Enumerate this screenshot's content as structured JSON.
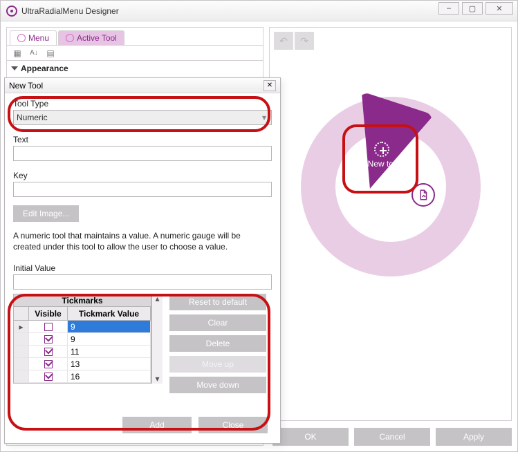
{
  "window": {
    "title": "UltraRadialMenu Designer",
    "buttons": {
      "min": "–",
      "max": "▢",
      "close": "✕"
    }
  },
  "tabs": {
    "menu": "Menu",
    "active_tool": "Active Tool"
  },
  "prop": {
    "section": "Appearance"
  },
  "preview": {
    "wedge_label": "New tool"
  },
  "footer": {
    "ok": "OK",
    "cancel": "Cancel",
    "apply": "Apply"
  },
  "modal": {
    "title": "New Tool",
    "tool_type_label": "Tool Type",
    "tool_type_value": "Numeric",
    "text_label": "Text",
    "text_value": "",
    "key_label": "Key",
    "key_value": "",
    "edit_image": "Edit Image...",
    "description": "A numeric tool that maintains a value. A numeric gauge will be created under this tool to allow the user to choose a value.",
    "initial_value_label": "Initial Value",
    "initial_value": "",
    "tickmarks": {
      "title": "Tickmarks",
      "col_visible": "Visible",
      "col_value": "Tickmark Value",
      "rows": [
        {
          "selected": true,
          "visible": false,
          "value": "9"
        },
        {
          "selected": false,
          "visible": true,
          "value": "9"
        },
        {
          "selected": false,
          "visible": true,
          "value": "11"
        },
        {
          "selected": false,
          "visible": true,
          "value": "13"
        },
        {
          "selected": false,
          "visible": true,
          "value": "16"
        }
      ]
    },
    "side": {
      "reset": "Reset to default",
      "clear": "Clear",
      "delete": "Delete",
      "move_up": "Move up",
      "move_down": "Move down"
    },
    "footer": {
      "add": "Add",
      "close": "Close"
    }
  }
}
